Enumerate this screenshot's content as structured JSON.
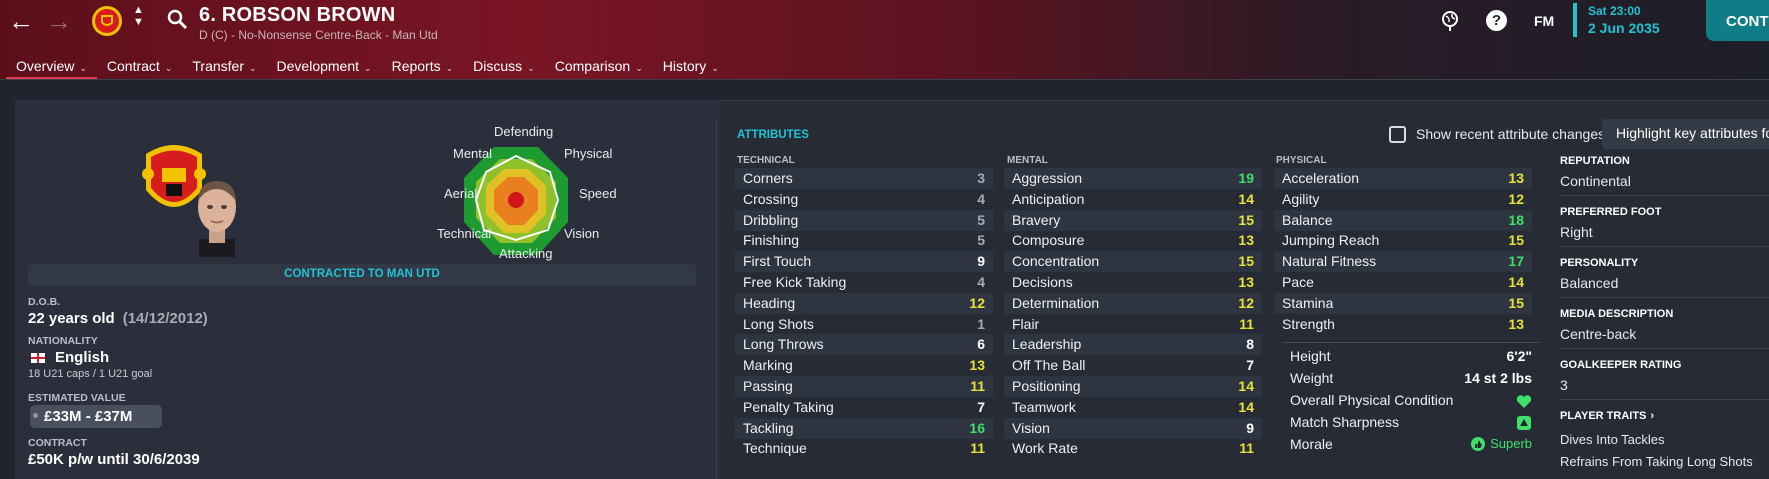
{
  "header": {
    "back_icon": "arrow-left-icon",
    "forward_icon": "arrow-right-icon",
    "player_title": "6. ROBSON BROWN",
    "player_subtitle": "D (C) - No-Nonsense Centre-Back - Man Utd",
    "date_time": "Sat 23:00",
    "date_day": "2 Jun 2035",
    "fm_label": "FM",
    "continue_label": "CONT",
    "help_label": "?",
    "accent_color": "#21c3d1"
  },
  "menu": [
    {
      "label": "Overview",
      "active": true
    },
    {
      "label": "Contract"
    },
    {
      "label": "Transfer"
    },
    {
      "label": "Development"
    },
    {
      "label": "Reports"
    },
    {
      "label": "Discuss"
    },
    {
      "label": "Comparison"
    },
    {
      "label": "History"
    }
  ],
  "radar": {
    "labels": [
      "Defending",
      "Physical",
      "Speed",
      "Vision",
      "Attacking",
      "Technical",
      "Aerial",
      "Mental"
    ]
  },
  "profile": {
    "contracted_banner": "CONTRACTED TO MAN UTD",
    "dob_label": "D.O.B.",
    "age": "22 years old",
    "dob": "(14/12/2012)",
    "nationality_label": "NATIONALITY",
    "nationality": "English",
    "caps": "18 U21 caps / 1 U21 goal",
    "value_label": "ESTIMATED VALUE",
    "value": "£33M - £37M",
    "contract_label": "CONTRACT",
    "contract": "£50K p/w until 30/6/2039"
  },
  "attributes": {
    "title": "ATTRIBUTES",
    "show_changes_label": "Show recent attribute changes",
    "highlight_label": "Highlight key attributes fo",
    "technical_header": "TECHNICAL",
    "mental_header": "MENTAL",
    "physical_header": "PHYSICAL",
    "technical": [
      {
        "name": "Corners",
        "value": "3"
      },
      {
        "name": "Crossing",
        "value": "4"
      },
      {
        "name": "Dribbling",
        "value": "5"
      },
      {
        "name": "Finishing",
        "value": "5"
      },
      {
        "name": "First Touch",
        "value": "9"
      },
      {
        "name": "Free Kick Taking",
        "value": "4"
      },
      {
        "name": "Heading",
        "value": "12"
      },
      {
        "name": "Long Shots",
        "value": "1"
      },
      {
        "name": "Long Throws",
        "value": "6"
      },
      {
        "name": "Marking",
        "value": "13"
      },
      {
        "name": "Passing",
        "value": "11"
      },
      {
        "name": "Penalty Taking",
        "value": "7"
      },
      {
        "name": "Tackling",
        "value": "16"
      },
      {
        "name": "Technique",
        "value": "11"
      }
    ],
    "mental": [
      {
        "name": "Aggression",
        "value": "19"
      },
      {
        "name": "Anticipation",
        "value": "14"
      },
      {
        "name": "Bravery",
        "value": "15"
      },
      {
        "name": "Composure",
        "value": "13"
      },
      {
        "name": "Concentration",
        "value": "15"
      },
      {
        "name": "Decisions",
        "value": "13"
      },
      {
        "name": "Determination",
        "value": "12"
      },
      {
        "name": "Flair",
        "value": "11"
      },
      {
        "name": "Leadership",
        "value": "8"
      },
      {
        "name": "Off The Ball",
        "value": "7"
      },
      {
        "name": "Positioning",
        "value": "14"
      },
      {
        "name": "Teamwork",
        "value": "14"
      },
      {
        "name": "Vision",
        "value": "9"
      },
      {
        "name": "Work Rate",
        "value": "11"
      }
    ],
    "physical": [
      {
        "name": "Acceleration",
        "value": "13"
      },
      {
        "name": "Agility",
        "value": "12"
      },
      {
        "name": "Balance",
        "value": "18"
      },
      {
        "name": "Jumping Reach",
        "value": "15"
      },
      {
        "name": "Natural Fitness",
        "value": "17"
      },
      {
        "name": "Pace",
        "value": "14"
      },
      {
        "name": "Stamina",
        "value": "15"
      },
      {
        "name": "Strength",
        "value": "13"
      }
    ],
    "physical_status": {
      "height_label": "Height",
      "height": "6'2\"",
      "weight_label": "Weight",
      "weight": "14 st 2 lbs",
      "condition_label": "Overall Physical Condition",
      "condition_icon": "heart-icon",
      "sharpness_label": "Match Sharpness",
      "sharpness_icon": "sharpness-icon",
      "morale_label": "Morale",
      "morale": "Superb",
      "morale_icon": "thumbs-up-icon"
    }
  },
  "right_info": {
    "reputation_label": "REPUTATION",
    "reputation": "Continental",
    "foot_label": "PREFERRED FOOT",
    "foot": "Right",
    "personality_label": "PERSONALITY",
    "personality": "Balanced",
    "media_label": "MEDIA DESCRIPTION",
    "media": "Centre-back",
    "gk_label": "GOALKEEPER RATING",
    "gk": "3",
    "traits_label": "PLAYER TRAITS",
    "traits": [
      "Dives Into Tackles",
      "Refrains From Taking Long Shots"
    ]
  },
  "colors": {
    "attr_low": "#a6abb5",
    "attr_mid": "#ffffff",
    "attr_good": "#e9e23a",
    "attr_great": "#3fe06a",
    "brand": "#7a1524"
  }
}
